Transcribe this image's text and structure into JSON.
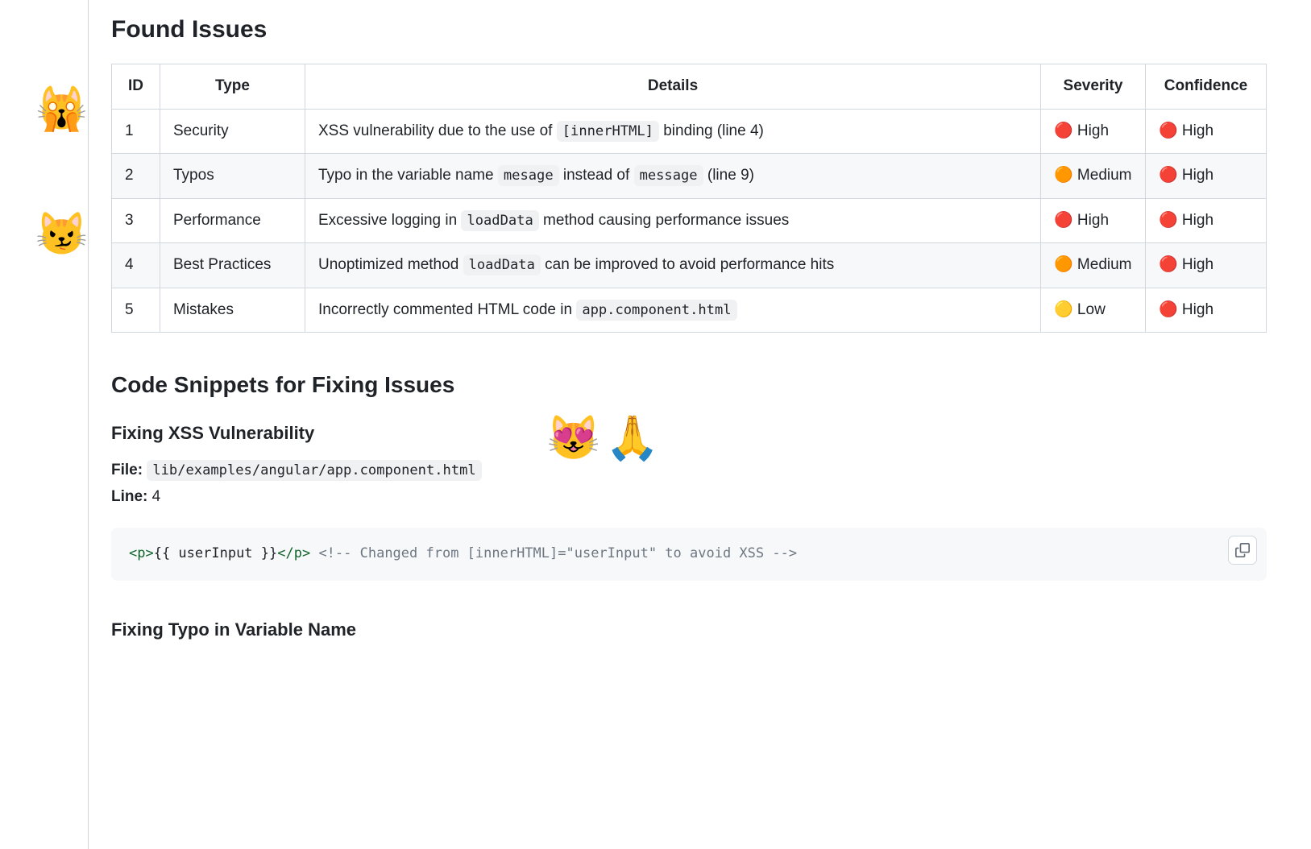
{
  "rail": {
    "emoji1": "🙀",
    "emoji2": "😼"
  },
  "headings": {
    "found_issues": "Found Issues",
    "code_snippets": "Code Snippets for Fixing Issues",
    "fix_xss": "Fixing XSS Vulnerability",
    "fix_typo": "Fixing Typo in Variable Name"
  },
  "table": {
    "headers": {
      "id": "ID",
      "type": "Type",
      "details": "Details",
      "severity": "Severity",
      "confidence": "Confidence"
    },
    "rows": [
      {
        "id": "1",
        "type": "Security",
        "details_pre": "XSS vulnerability due to the use of ",
        "details_code": "[innerHTML]",
        "details_post": " binding (line 4)",
        "severity": "🔴 High",
        "confidence": "🔴 High"
      },
      {
        "id": "2",
        "type": "Typos",
        "details_pre": "Typo in the variable name ",
        "details_code": "mesage",
        "details_mid": " instead of ",
        "details_code2": "message",
        "details_post": " (line 9)",
        "severity": "🟠 Medium",
        "confidence": "🔴 High"
      },
      {
        "id": "3",
        "type": "Performance",
        "details_pre": "Excessive logging in ",
        "details_code": "loadData",
        "details_post": " method causing performance issues",
        "severity": "🔴 High",
        "confidence": "🔴 High"
      },
      {
        "id": "4",
        "type": "Best Practices",
        "details_pre": "Unoptimized method ",
        "details_code": "loadData",
        "details_post": " can be improved to avoid performance hits",
        "severity": "🟠 Medium",
        "confidence": "🔴 High"
      },
      {
        "id": "5",
        "type": "Mistakes",
        "details_pre": "Incorrectly commented HTML code in ",
        "details_code": "app.component.html",
        "details_post": "",
        "severity": "🟡 Low",
        "confidence": "🔴 High"
      }
    ]
  },
  "fix_xss": {
    "file_label": "File:",
    "file_value": "lib/examples/angular/app.component.html",
    "line_label": "Line:",
    "line_value": "4",
    "code_tag_open": "<p>",
    "code_interp": "{{ userInput }}",
    "code_tag_close": "</p>",
    "code_comment": " <!-- Changed from [innerHTML]=\"userInput\" to avoid XSS -->"
  },
  "float_emoji": {
    "e1": "😻",
    "e2": "🙏"
  }
}
